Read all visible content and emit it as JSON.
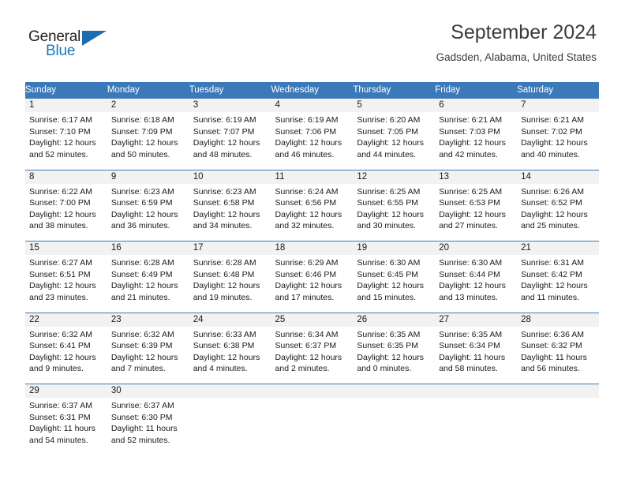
{
  "brand": {
    "logo_text_top": "General",
    "logo_text_bottom": "Blue",
    "wedge_icon": "triangle-wedge-icon",
    "color_dark": "#231f20",
    "color_blue": "#1878be"
  },
  "header": {
    "title": "September 2024",
    "location": "Gadsden, Alabama, United States"
  },
  "theme": {
    "header_blue": "#3b79b8",
    "daynum_gray": "#f2f2f2",
    "text_dark": "#1a1a1a",
    "title_gray": "#3c3c3c"
  },
  "calendar": {
    "weekday_headers": [
      "Sunday",
      "Monday",
      "Tuesday",
      "Wednesday",
      "Thursday",
      "Friday",
      "Saturday"
    ],
    "weeks": [
      [
        {
          "day": "1",
          "sunrise": "Sunrise: 6:17 AM",
          "sunset": "Sunset: 7:10 PM",
          "daylight_line1": "Daylight: 12 hours",
          "daylight_line2": "and 52 minutes."
        },
        {
          "day": "2",
          "sunrise": "Sunrise: 6:18 AM",
          "sunset": "Sunset: 7:09 PM",
          "daylight_line1": "Daylight: 12 hours",
          "daylight_line2": "and 50 minutes."
        },
        {
          "day": "3",
          "sunrise": "Sunrise: 6:19 AM",
          "sunset": "Sunset: 7:07 PM",
          "daylight_line1": "Daylight: 12 hours",
          "daylight_line2": "and 48 minutes."
        },
        {
          "day": "4",
          "sunrise": "Sunrise: 6:19 AM",
          "sunset": "Sunset: 7:06 PM",
          "daylight_line1": "Daylight: 12 hours",
          "daylight_line2": "and 46 minutes."
        },
        {
          "day": "5",
          "sunrise": "Sunrise: 6:20 AM",
          "sunset": "Sunset: 7:05 PM",
          "daylight_line1": "Daylight: 12 hours",
          "daylight_line2": "and 44 minutes."
        },
        {
          "day": "6",
          "sunrise": "Sunrise: 6:21 AM",
          "sunset": "Sunset: 7:03 PM",
          "daylight_line1": "Daylight: 12 hours",
          "daylight_line2": "and 42 minutes."
        },
        {
          "day": "7",
          "sunrise": "Sunrise: 6:21 AM",
          "sunset": "Sunset: 7:02 PM",
          "daylight_line1": "Daylight: 12 hours",
          "daylight_line2": "and 40 minutes."
        }
      ],
      [
        {
          "day": "8",
          "sunrise": "Sunrise: 6:22 AM",
          "sunset": "Sunset: 7:00 PM",
          "daylight_line1": "Daylight: 12 hours",
          "daylight_line2": "and 38 minutes."
        },
        {
          "day": "9",
          "sunrise": "Sunrise: 6:23 AM",
          "sunset": "Sunset: 6:59 PM",
          "daylight_line1": "Daylight: 12 hours",
          "daylight_line2": "and 36 minutes."
        },
        {
          "day": "10",
          "sunrise": "Sunrise: 6:23 AM",
          "sunset": "Sunset: 6:58 PM",
          "daylight_line1": "Daylight: 12 hours",
          "daylight_line2": "and 34 minutes."
        },
        {
          "day": "11",
          "sunrise": "Sunrise: 6:24 AM",
          "sunset": "Sunset: 6:56 PM",
          "daylight_line1": "Daylight: 12 hours",
          "daylight_line2": "and 32 minutes."
        },
        {
          "day": "12",
          "sunrise": "Sunrise: 6:25 AM",
          "sunset": "Sunset: 6:55 PM",
          "daylight_line1": "Daylight: 12 hours",
          "daylight_line2": "and 30 minutes."
        },
        {
          "day": "13",
          "sunrise": "Sunrise: 6:25 AM",
          "sunset": "Sunset: 6:53 PM",
          "daylight_line1": "Daylight: 12 hours",
          "daylight_line2": "and 27 minutes."
        },
        {
          "day": "14",
          "sunrise": "Sunrise: 6:26 AM",
          "sunset": "Sunset: 6:52 PM",
          "daylight_line1": "Daylight: 12 hours",
          "daylight_line2": "and 25 minutes."
        }
      ],
      [
        {
          "day": "15",
          "sunrise": "Sunrise: 6:27 AM",
          "sunset": "Sunset: 6:51 PM",
          "daylight_line1": "Daylight: 12 hours",
          "daylight_line2": "and 23 minutes."
        },
        {
          "day": "16",
          "sunrise": "Sunrise: 6:28 AM",
          "sunset": "Sunset: 6:49 PM",
          "daylight_line1": "Daylight: 12 hours",
          "daylight_line2": "and 21 minutes."
        },
        {
          "day": "17",
          "sunrise": "Sunrise: 6:28 AM",
          "sunset": "Sunset: 6:48 PM",
          "daylight_line1": "Daylight: 12 hours",
          "daylight_line2": "and 19 minutes."
        },
        {
          "day": "18",
          "sunrise": "Sunrise: 6:29 AM",
          "sunset": "Sunset: 6:46 PM",
          "daylight_line1": "Daylight: 12 hours",
          "daylight_line2": "and 17 minutes."
        },
        {
          "day": "19",
          "sunrise": "Sunrise: 6:30 AM",
          "sunset": "Sunset: 6:45 PM",
          "daylight_line1": "Daylight: 12 hours",
          "daylight_line2": "and 15 minutes."
        },
        {
          "day": "20",
          "sunrise": "Sunrise: 6:30 AM",
          "sunset": "Sunset: 6:44 PM",
          "daylight_line1": "Daylight: 12 hours",
          "daylight_line2": "and 13 minutes."
        },
        {
          "day": "21",
          "sunrise": "Sunrise: 6:31 AM",
          "sunset": "Sunset: 6:42 PM",
          "daylight_line1": "Daylight: 12 hours",
          "daylight_line2": "and 11 minutes."
        }
      ],
      [
        {
          "day": "22",
          "sunrise": "Sunrise: 6:32 AM",
          "sunset": "Sunset: 6:41 PM",
          "daylight_line1": "Daylight: 12 hours",
          "daylight_line2": "and 9 minutes."
        },
        {
          "day": "23",
          "sunrise": "Sunrise: 6:32 AM",
          "sunset": "Sunset: 6:39 PM",
          "daylight_line1": "Daylight: 12 hours",
          "daylight_line2": "and 7 minutes."
        },
        {
          "day": "24",
          "sunrise": "Sunrise: 6:33 AM",
          "sunset": "Sunset: 6:38 PM",
          "daylight_line1": "Daylight: 12 hours",
          "daylight_line2": "and 4 minutes."
        },
        {
          "day": "25",
          "sunrise": "Sunrise: 6:34 AM",
          "sunset": "Sunset: 6:37 PM",
          "daylight_line1": "Daylight: 12 hours",
          "daylight_line2": "and 2 minutes."
        },
        {
          "day": "26",
          "sunrise": "Sunrise: 6:35 AM",
          "sunset": "Sunset: 6:35 PM",
          "daylight_line1": "Daylight: 12 hours",
          "daylight_line2": "and 0 minutes."
        },
        {
          "day": "27",
          "sunrise": "Sunrise: 6:35 AM",
          "sunset": "Sunset: 6:34 PM",
          "daylight_line1": "Daylight: 11 hours",
          "daylight_line2": "and 58 minutes."
        },
        {
          "day": "28",
          "sunrise": "Sunrise: 6:36 AM",
          "sunset": "Sunset: 6:32 PM",
          "daylight_line1": "Daylight: 11 hours",
          "daylight_line2": "and 56 minutes."
        }
      ],
      [
        {
          "day": "29",
          "sunrise": "Sunrise: 6:37 AM",
          "sunset": "Sunset: 6:31 PM",
          "daylight_line1": "Daylight: 11 hours",
          "daylight_line2": "and 54 minutes."
        },
        {
          "day": "30",
          "sunrise": "Sunrise: 6:37 AM",
          "sunset": "Sunset: 6:30 PM",
          "daylight_line1": "Daylight: 11 hours",
          "daylight_line2": "and 52 minutes."
        },
        {
          "day": "",
          "sunrise": "",
          "sunset": "",
          "daylight_line1": "",
          "daylight_line2": ""
        },
        {
          "day": "",
          "sunrise": "",
          "sunset": "",
          "daylight_line1": "",
          "daylight_line2": ""
        },
        {
          "day": "",
          "sunrise": "",
          "sunset": "",
          "daylight_line1": "",
          "daylight_line2": ""
        },
        {
          "day": "",
          "sunrise": "",
          "sunset": "",
          "daylight_line1": "",
          "daylight_line2": ""
        },
        {
          "day": "",
          "sunrise": "",
          "sunset": "",
          "daylight_line1": "",
          "daylight_line2": ""
        }
      ]
    ]
  }
}
